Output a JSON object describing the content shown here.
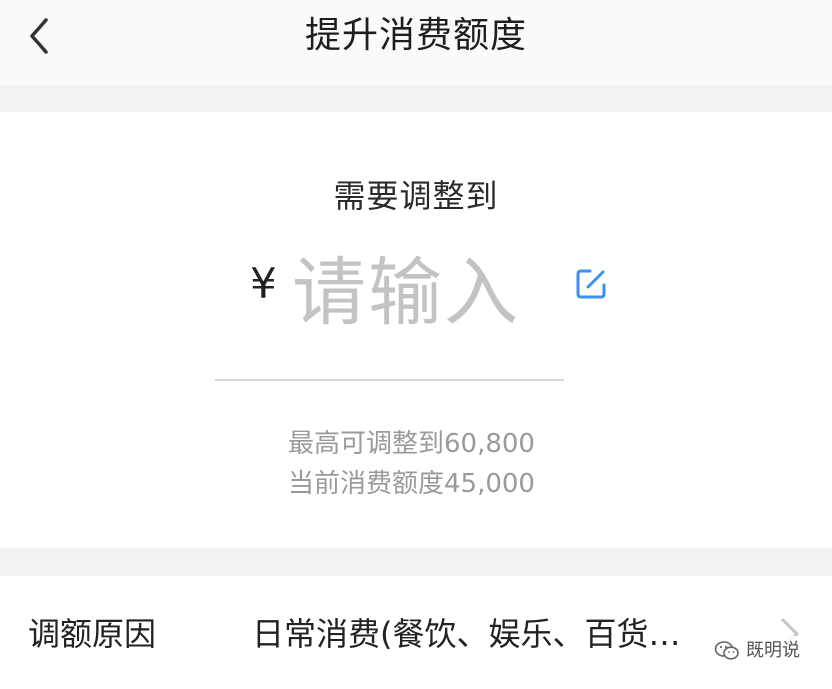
{
  "header": {
    "title": "提升消费额度",
    "back_icon": "chevron-left-icon"
  },
  "amount": {
    "prompt": "需要调整到",
    "currency_symbol": "¥",
    "placeholder": "请输入",
    "value": "",
    "edit_icon": "edit-icon",
    "accent_color": "#3d8ff2"
  },
  "limits": {
    "max_line": "最高可调整到60,800",
    "current_line": "当前消费额度45,000"
  },
  "reason": {
    "label": "调额原因",
    "value": "日常消费(餐饮、娱乐、百货…",
    "chevron_icon": "chevron-right-icon"
  },
  "watermark": {
    "text": "既明说",
    "icon": "wechat-icon"
  }
}
